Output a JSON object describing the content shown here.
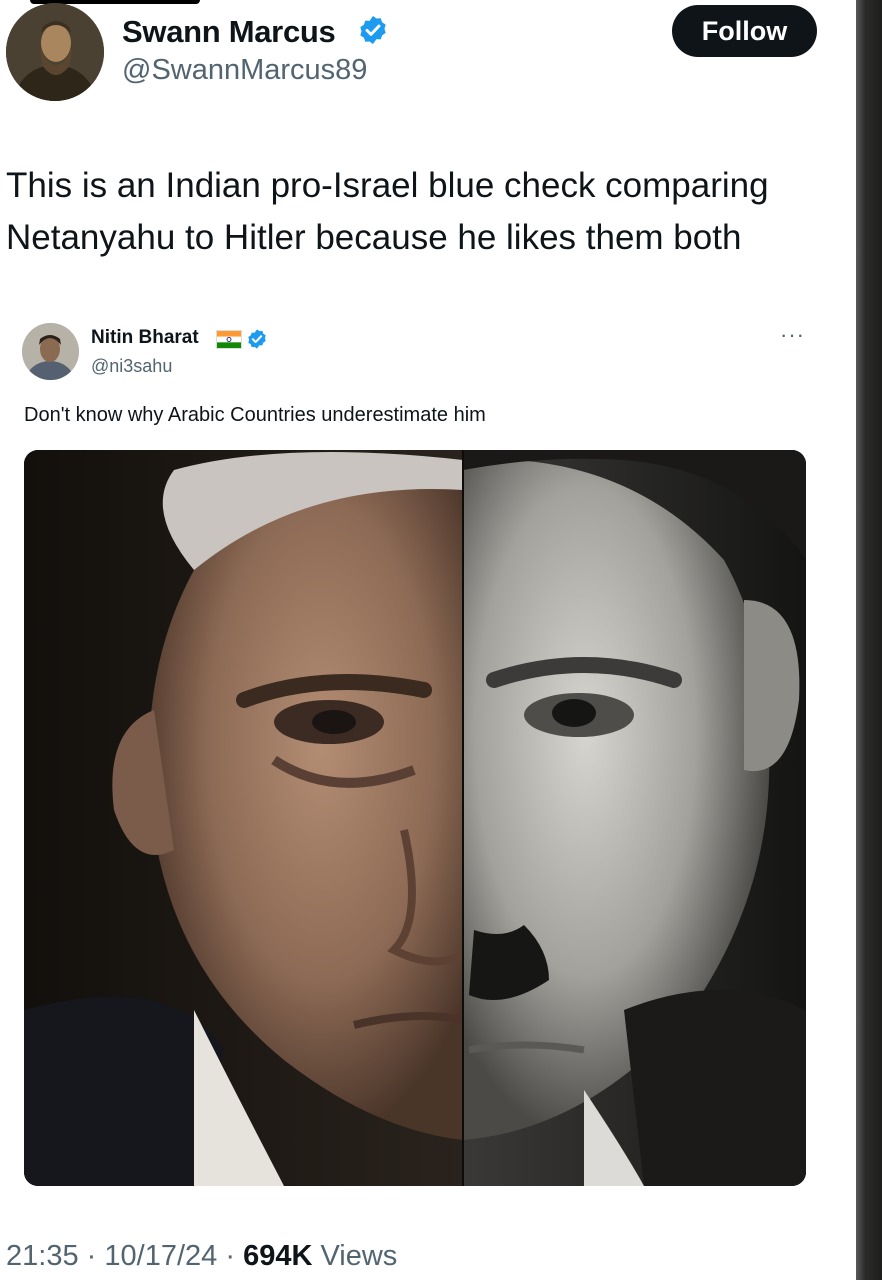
{
  "tweet": {
    "author_name": "Swann Marcus",
    "author_handle": "@SwannMarcus89",
    "follow_label": "Follow",
    "text": "This is an Indian pro-Israel blue check comparing Netanyahu to Hitler because he likes them both",
    "time": "21:35",
    "separator": "·",
    "date": "10/17/24",
    "views_count": "694K",
    "views_label": "Views"
  },
  "quoted": {
    "author_name": "Nitin Bharat",
    "author_handle": "@ni3sahu",
    "more_label": "···",
    "text": "Don't know why Arabic Countries underestimate him",
    "media_icon": "split-face-portrait-image"
  },
  "colors": {
    "text_primary": "#0f1419",
    "text_secondary": "#536471",
    "verified_blue": "#1d9bf0",
    "follow_bg": "#0f1419"
  }
}
